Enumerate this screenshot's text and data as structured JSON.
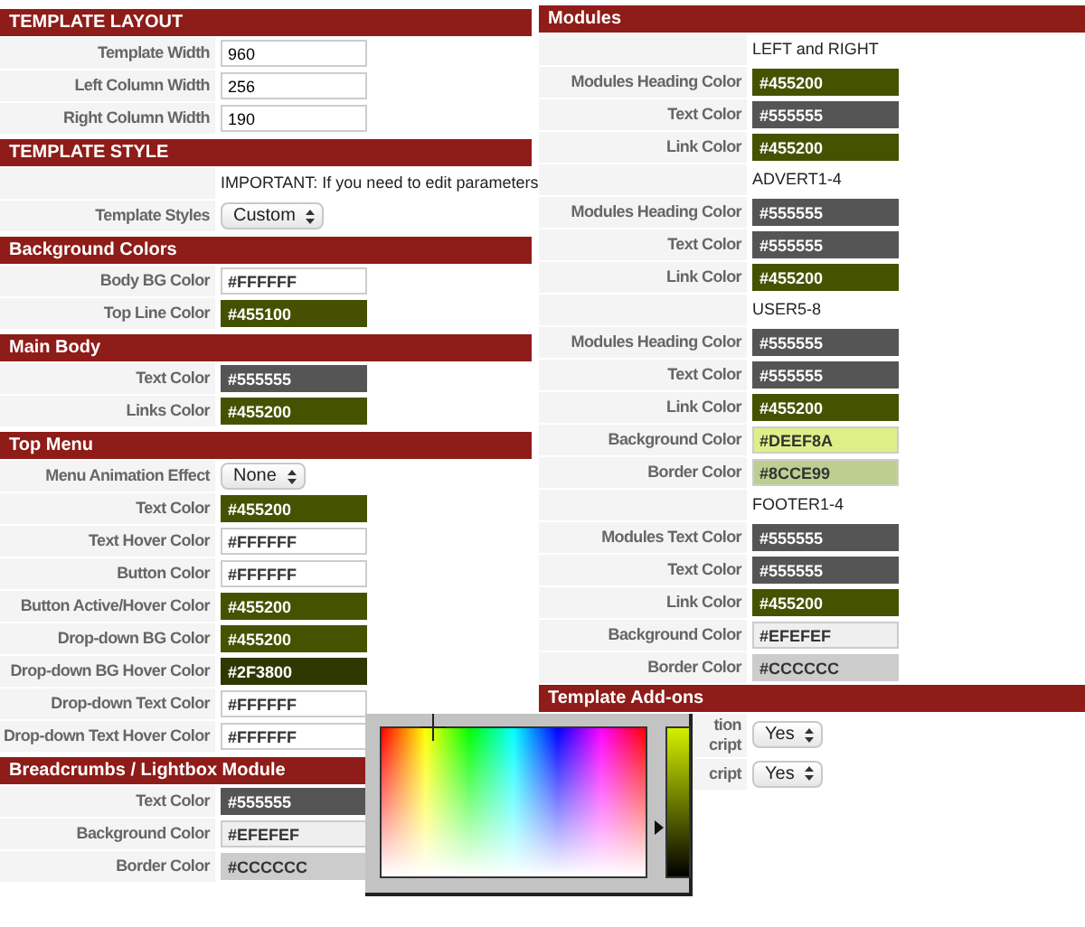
{
  "left": [
    {
      "title": "TEMPLATE LAYOUT",
      "rows": [
        {
          "kind": "text",
          "label": "Template Width",
          "value": "960"
        },
        {
          "kind": "text",
          "label": "Left Column Width",
          "value": "256"
        },
        {
          "kind": "text",
          "label": "Right Column Width",
          "value": "190"
        }
      ]
    },
    {
      "title": "TEMPLATE STYLE",
      "rows": [
        {
          "kind": "note",
          "value": "IMPORTANT: If you need to edit parameters"
        },
        {
          "kind": "select",
          "label": "Template Styles",
          "value": "Custom"
        }
      ]
    },
    {
      "title": "Background Colors",
      "rows": [
        {
          "kind": "color",
          "label": "Body BG Color",
          "value": "#FFFFFF",
          "color": "#ffffff"
        },
        {
          "kind": "color",
          "label": "Top Line Color",
          "value": "#455100",
          "color": "#455100"
        }
      ]
    },
    {
      "title": "Main Body",
      "rows": [
        {
          "kind": "color",
          "label": "Text Color",
          "value": "#555555",
          "color": "#555555"
        },
        {
          "kind": "color",
          "label": "Links Color",
          "value": "#455200",
          "color": "#455200"
        }
      ]
    },
    {
      "title": "Top Menu",
      "rows": [
        {
          "kind": "select",
          "label": "Menu Animation Effect",
          "value": "None"
        },
        {
          "kind": "color",
          "label": "Text Color",
          "value": "#455200",
          "color": "#455200"
        },
        {
          "kind": "color",
          "label": "Text Hover Color",
          "value": "#FFFFFF",
          "color": "#ffffff"
        },
        {
          "kind": "color",
          "label": "Button Color",
          "value": "#FFFFFF",
          "color": "#ffffff"
        },
        {
          "kind": "color",
          "label": "Button Active/Hover Color",
          "value": "#455200",
          "color": "#455200"
        },
        {
          "kind": "color",
          "label": "Drop-down BG Color",
          "value": "#455200",
          "color": "#455200"
        },
        {
          "kind": "color",
          "label": "Drop-down BG Hover Color",
          "value": "#2F3800",
          "color": "#2f3800"
        },
        {
          "kind": "color",
          "label": "Drop-down Text Color",
          "value": "#FFFFFF",
          "color": "#ffffff"
        },
        {
          "kind": "color",
          "label": "Drop-down Text Hover Color",
          "value": "#FFFFFF",
          "color": "#ffffff"
        }
      ]
    },
    {
      "title": "Breadcrumbs / Lightbox Module",
      "rows": [
        {
          "kind": "color",
          "label": "Text Color",
          "value": "#555555",
          "color": "#555555"
        },
        {
          "kind": "color",
          "label": "Background Color",
          "value": "#EFEFEF",
          "color": "#efefef"
        },
        {
          "kind": "color",
          "label": "Border Color",
          "value": "#CCCCCC",
          "color": "#cccccc"
        }
      ]
    }
  ],
  "right": [
    {
      "title": "Modules",
      "rows": [
        {
          "kind": "note",
          "value": "LEFT and RIGHT"
        },
        {
          "kind": "color",
          "label": "Modules Heading Color",
          "value": "#455200",
          "color": "#455200"
        },
        {
          "kind": "color",
          "label": "Text Color",
          "value": "#555555",
          "color": "#555555"
        },
        {
          "kind": "color",
          "label": "Link Color",
          "value": "#455200",
          "color": "#455200"
        },
        {
          "kind": "note",
          "value": "ADVERT1-4"
        },
        {
          "kind": "color",
          "label": "Modules Heading Color",
          "value": "#555555",
          "color": "#555555"
        },
        {
          "kind": "color",
          "label": "Text Color",
          "value": "#555555",
          "color": "#555555"
        },
        {
          "kind": "color",
          "label": "Link Color",
          "value": "#455200",
          "color": "#455200"
        },
        {
          "kind": "note",
          "value": "USER5-8"
        },
        {
          "kind": "color",
          "label": "Modules Heading Color",
          "value": "#555555",
          "color": "#555555"
        },
        {
          "kind": "color",
          "label": "Text Color",
          "value": "#555555",
          "color": "#555555"
        },
        {
          "kind": "color",
          "label": "Link Color",
          "value": "#455200",
          "color": "#455200"
        },
        {
          "kind": "color",
          "label": "Background Color",
          "value": "#DEEF8A",
          "color": "#deef8a"
        },
        {
          "kind": "color",
          "label": "Border Color",
          "value": "#8CCE99",
          "color": "#bccf90"
        },
        {
          "kind": "note",
          "value": "FOOTER1-4"
        },
        {
          "kind": "color",
          "label": "Modules Text Color",
          "value": "#555555",
          "color": "#555555"
        },
        {
          "kind": "color",
          "label": "Text Color",
          "value": "#555555",
          "color": "#555555"
        },
        {
          "kind": "color",
          "label": "Link Color",
          "value": "#455200",
          "color": "#455200"
        },
        {
          "kind": "color",
          "label": "Background Color",
          "value": "#EFEFEF",
          "color": "#efefef"
        },
        {
          "kind": "color",
          "label": "Border Color",
          "value": "#CCCCCC",
          "color": "#cccccc"
        }
      ]
    },
    {
      "title": "Template Add-ons",
      "rows": [
        {
          "kind": "select",
          "label_lines": [
            "tion",
            "cript"
          ],
          "value": "Yes"
        },
        {
          "kind": "select",
          "label_lines": [
            "cript"
          ],
          "value": "Yes"
        }
      ]
    }
  ],
  "color_picker": {
    "level": 0.33
  }
}
